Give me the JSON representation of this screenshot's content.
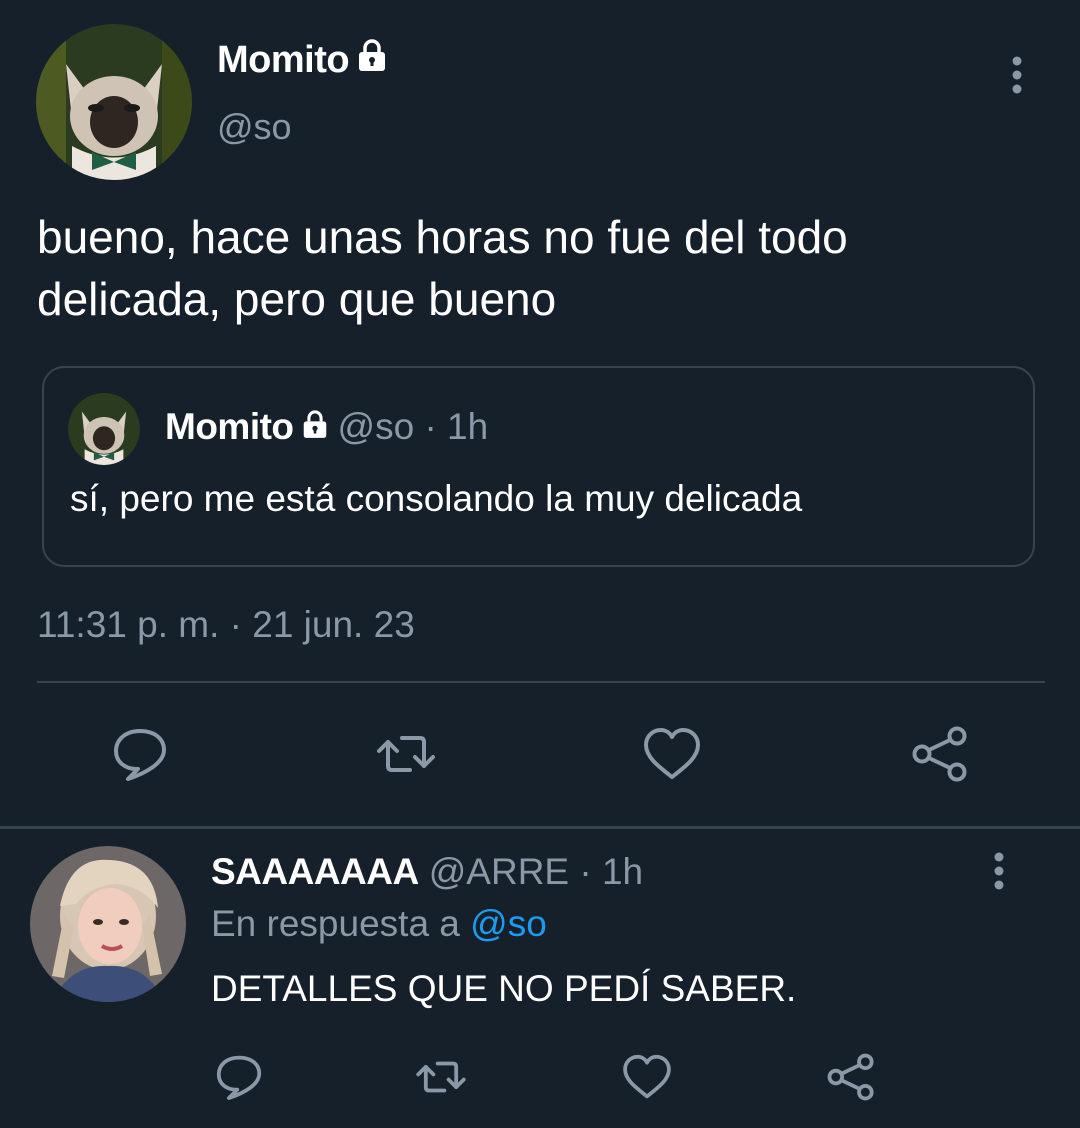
{
  "theme": {
    "background": "#15202b",
    "text": "#ffffff",
    "secondary_text": "#8b98a5",
    "border": "#38444d",
    "link": "#1d9bf0"
  },
  "main_tweet": {
    "display_name": "Momito",
    "protected_icon": "lock-icon",
    "handle": "@so",
    "avatar": "cat-avatar",
    "more_icon": "more-vertical-icon",
    "text_line1": "bueno, hace unas horas no fue del todo",
    "text_line2": "delicada, pero que bueno",
    "quoted": {
      "display_name": "Momito",
      "handle_time": "@so · 1h",
      "text": "sí, pero me está consolando la muy delicada"
    },
    "timestamp": "11:31 p. m. · 21 jun. 23",
    "actions": [
      "reply-icon",
      "retweet-icon",
      "like-icon",
      "share-icon"
    ]
  },
  "reply": {
    "display_name": "SAAAAAAA",
    "handle_time": "@ARRE · 1h",
    "in_reply_prefix": "En respuesta a",
    "in_reply_mention": "@so",
    "text": "DETALLES QUE NO PEDÍ SABER.",
    "avatar": "person-avatar",
    "more_icon": "more-vertical-icon",
    "actions": [
      "reply-icon",
      "retweet-icon",
      "like-icon",
      "share-icon"
    ]
  }
}
